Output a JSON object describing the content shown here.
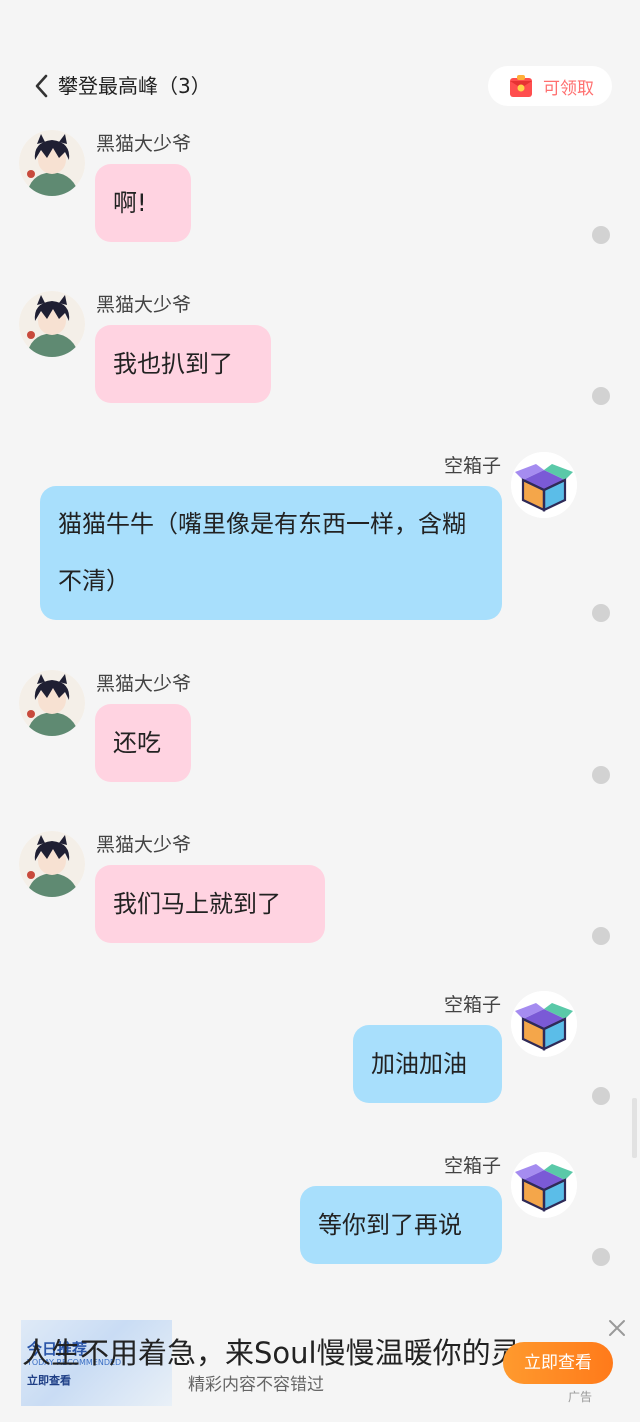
{
  "header": {
    "title": "攀登最高峰（3）",
    "reward_label": "可领取"
  },
  "messages": [
    {
      "sender": "黑猫大少爷",
      "side": "left",
      "text": "啊!"
    },
    {
      "sender": "黑猫大少爷",
      "side": "left",
      "text": "我也扒到了"
    },
    {
      "sender": "空箱子",
      "side": "right",
      "text": "猫猫牛牛（嘴里像是有东西一样，含糊不清）"
    },
    {
      "sender": "黑猫大少爷",
      "side": "left",
      "text": "还吃"
    },
    {
      "sender": "黑猫大少爷",
      "side": "left",
      "text": "我们马上就到了"
    },
    {
      "sender": "空箱子",
      "side": "right",
      "text": "加油加油"
    },
    {
      "sender": "空箱子",
      "side": "right",
      "text": "等你到了再说"
    }
  ],
  "ad": {
    "thumb_title": "今日推荐",
    "thumb_subtitle": "TODAY RECOMMENDED",
    "thumb_cta": "立即查看",
    "headline": "人生不用着急，来Soul慢慢温暖你的灵",
    "subtitle": "精彩内容不容错过",
    "cta": "立即查看",
    "tag": "广告"
  },
  "colors": {
    "background": "#f5f5f5",
    "bubble_left": "#ffd3e1",
    "bubble_right": "#a8dffc",
    "reward_text": "#ff6f6f",
    "ad_button": "#ff8a25"
  },
  "icons": {
    "back": "chevron-left-icon",
    "reward": "red-envelope-icon",
    "avatar_left": "anime-boy-avatar",
    "avatar_right": "box-avatar",
    "ad_close": "close-icon"
  }
}
